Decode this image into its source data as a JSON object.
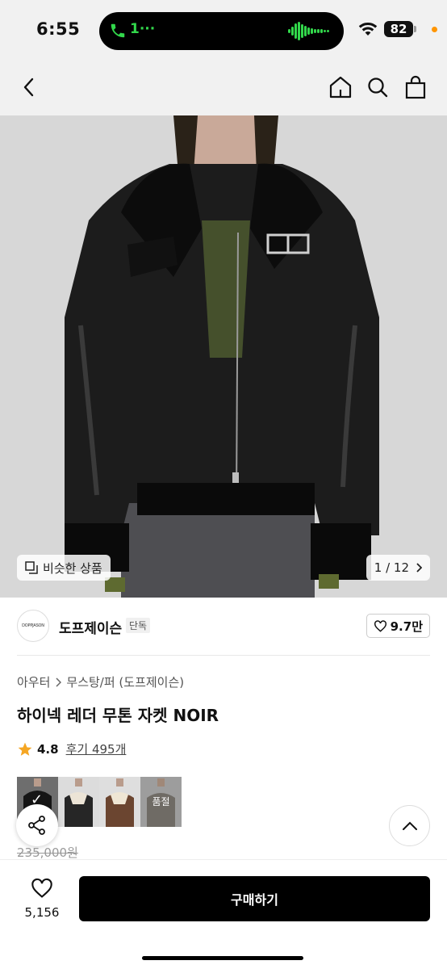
{
  "status_bar": {
    "time": "6:55",
    "call_text": "1···",
    "battery": "82",
    "icons": [
      "phone-icon",
      "audio-wave-icon",
      "wifi-icon",
      "battery-icon"
    ]
  },
  "nav": {
    "icons": [
      "back-chevron-icon",
      "home-icon",
      "search-icon",
      "shopping-bag-icon"
    ]
  },
  "gallery": {
    "similar_label": "비슷한 상품",
    "page_indicator": "1 / 12"
  },
  "brand": {
    "logo_text": "DOPPJASON",
    "name": "도프제이슨",
    "tag": "단독",
    "likes": "9.7만"
  },
  "product": {
    "category_parent": "아우터",
    "category_child": "무스탕/퍼 (도프제이슨)",
    "title": "하이넥 레더 무톤 자켓 NOIR",
    "rating": "4.8",
    "reviews": "후기 495개",
    "soldout_label": "품절",
    "original_price": "235,000원"
  },
  "bottom_bar": {
    "favorites_count": "5,156",
    "buy_label": "구매하기"
  },
  "colors": {
    "accent": "#000000",
    "star": "#f5a623",
    "call_green": "#32d74b"
  }
}
